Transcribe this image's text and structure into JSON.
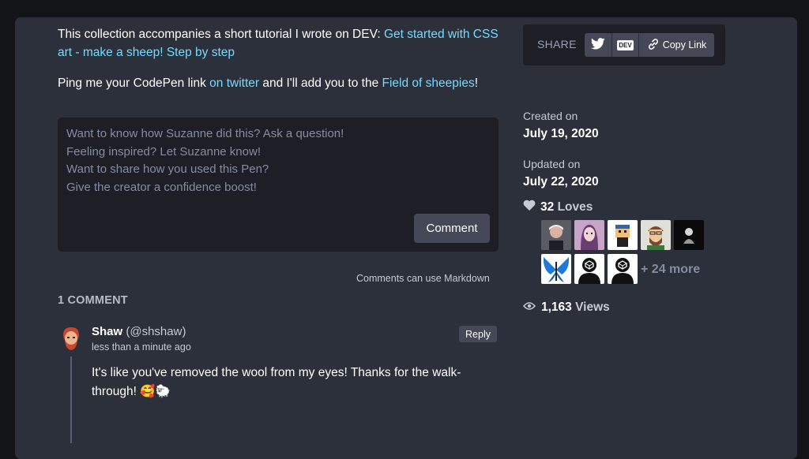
{
  "intro": {
    "line1_text": "This collection accompanies a short tutorial I wrote on DEV: ",
    "line1_link": "Get started with CSS art - make a sheep! Step by step",
    "line2_prefix": "Ping me your CodePen link ",
    "line2_link1": "on twitter",
    "line2_middle": " and I'll add you to the ",
    "line2_link2": "Field of sheepies",
    "line2_suffix": "!"
  },
  "comment_form": {
    "placeholder": "Want to know how Suzanne did this? Ask a question!\nFeeling inspired? Let Suzanne know!\nWant to share how you used this Pen?\nGive the creator a confidence boost!",
    "submit_label": "Comment",
    "markdown_note": "Comments can use Markdown"
  },
  "comments": {
    "count_heading": "1 COMMENT",
    "items": [
      {
        "name": "Shaw",
        "handle": "(@shshaw)",
        "time": "less than a minute ago",
        "reply_label": "Reply",
        "body": "It's like you've removed the wool from my eyes! Thanks for the walk-through! 🥰🐑"
      }
    ]
  },
  "sidebar": {
    "share_label": "SHARE",
    "copy_link_label": "Copy Link",
    "dev_label": "DEV",
    "created_label": "Created on",
    "created_value": "July 19, 2020",
    "updated_label": "Updated on",
    "updated_value": "July 22, 2020",
    "loves_count": "32",
    "loves_label": "Loves",
    "more_label": "+ 24 more",
    "views_count": "1,163",
    "views_label": "Views"
  },
  "colors": {
    "accent_link": "#76daff",
    "panel_bg": "#2c303a",
    "page_bg": "#131417"
  }
}
